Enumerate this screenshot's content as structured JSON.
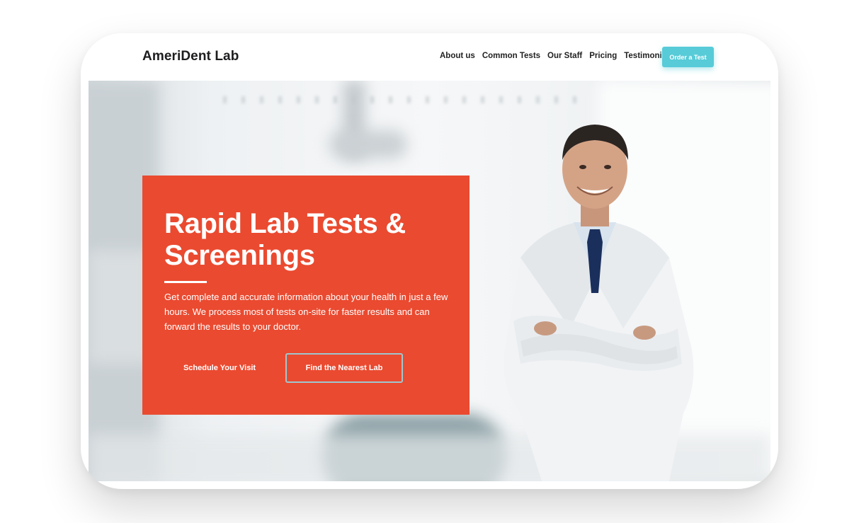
{
  "site": {
    "brand": "AmeriDent Lab"
  },
  "nav": {
    "items": [
      {
        "label": "About us"
      },
      {
        "label": "Common Tests"
      },
      {
        "label": "Our Staff"
      },
      {
        "label": "Pricing"
      },
      {
        "label": "Testimonials"
      }
    ],
    "cta_label": "Order a Test"
  },
  "hero": {
    "headline_line1": "Rapid Lab Tests &",
    "headline_line2": "Screenings",
    "description": "Get complete and accurate information about your health in just a few hours. We process most of tests on-site for faster results and can forward the results to your doctor.",
    "primary_button": "Schedule Your Visit",
    "secondary_button": "Find the Nearest Lab"
  },
  "colors": {
    "accent_red": "#ea4a30",
    "accent_teal": "#57cbd8",
    "text_dark": "#1d1d1f"
  },
  "icons": {
    "hero_image": "doctor-photo"
  }
}
